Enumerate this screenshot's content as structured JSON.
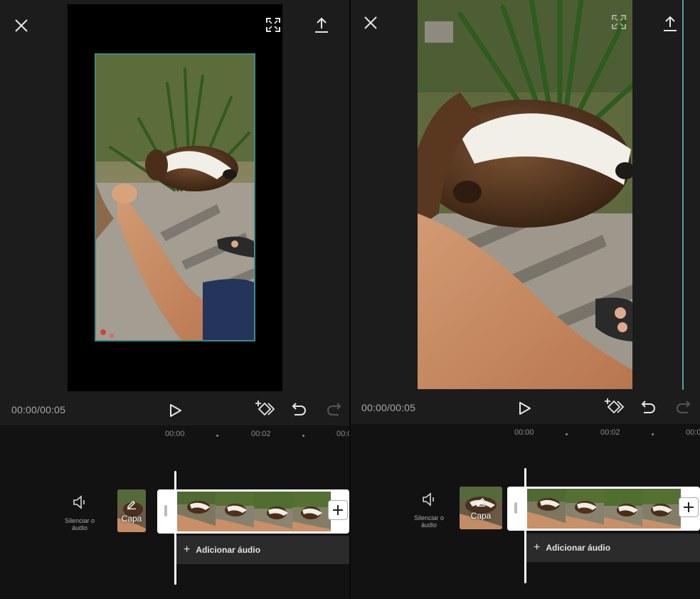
{
  "screens": [
    {
      "timecode": "00:00/00:05",
      "ruler": {
        "t0": "00:00",
        "t1": "00:02",
        "t2": "00:0"
      },
      "mute_label_line1": "Silenciar o",
      "mute_label_line2": "áudio",
      "cover_label": "Capa",
      "add_audio_label": "Adicionar áudio"
    },
    {
      "timecode": "00:00/00:05",
      "ruler": {
        "t0": "00:00",
        "t1": "00:02",
        "t2": "00:0"
      },
      "mute_label_line1": "Silenciar o",
      "mute_label_line2": "áudio",
      "cover_label": "Capa",
      "add_audio_label": "Adicionar áudio"
    }
  ],
  "colors": {
    "accent_teal": "#4ba7a2",
    "background": "#1a1a1a",
    "timeline_background": "#121212"
  },
  "icons": [
    "close-icon",
    "fullscreen-icon",
    "export-icon",
    "play-icon",
    "keyframe-icon",
    "undo-icon",
    "redo-icon",
    "speaker-icon",
    "pencil-icon",
    "plus-icon"
  ]
}
